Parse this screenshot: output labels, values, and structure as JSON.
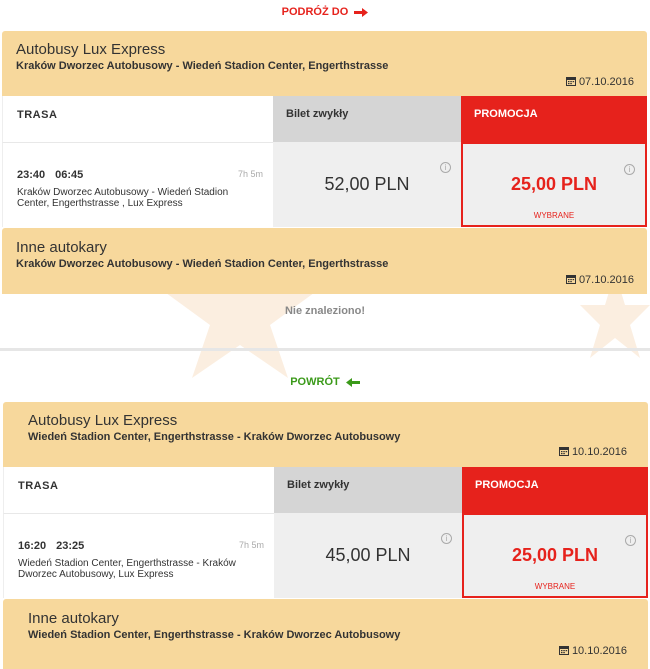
{
  "outbound": {
    "heading": "PODRÓŻ DO",
    "heading_color": "#e6221c",
    "lux": {
      "company": "Autobusy Lux Express",
      "route": "Kraków Dworzec Autobusowy - Wiedeń Stadion Center, Engerthstrasse",
      "date": "07.10.2016",
      "col_trasa": "TRASA",
      "col_bilet": "Bilet zwykły",
      "col_promo": "PROMOCJA",
      "dep": "23:40",
      "arr": "06:45",
      "duration": "7h 5m",
      "desc": "Kraków Dworzec Autobusowy - Wiedeń Stadion Center, Engerthstrasse , Lux Express",
      "price_regular": "52,00 PLN",
      "price_promo": "25,00 PLN",
      "selected": "WYBRANE"
    },
    "other": {
      "company": "Inne autokary",
      "route": "Kraków Dworzec Autobusowy - Wiedeń Stadion Center, Engerthstrasse",
      "date": "07.10.2016",
      "not_found": "Nie znaleziono!"
    }
  },
  "return": {
    "heading": "POWRÓT",
    "heading_color": "#3b9a1a",
    "lux": {
      "company": "Autobusy Lux Express",
      "route": "Wiedeń Stadion Center, Engerthstrasse - Kraków Dworzec Autobusowy",
      "date": "10.10.2016",
      "col_trasa": "TRASA",
      "col_bilet": "Bilet zwykły",
      "col_promo": "PROMOCJA",
      "dep": "16:20",
      "arr": "23:25",
      "duration": "7h 5m",
      "desc": "Wiedeń Stadion Center, Engerthstrasse - Kraków Dworzec Autobusowy, Lux Express",
      "price_regular": "45,00 PLN",
      "price_promo": "25,00 PLN",
      "selected": "WYBRANE"
    },
    "other": {
      "company": "Inne autokary",
      "route": "Wiedeń Stadion Center, Engerthstrasse - Kraków Dworzec Autobusowy",
      "date": "10.10.2016"
    }
  },
  "icons": {
    "info": "i",
    "calendar": "calendar-icon",
    "arrow_right": "arrow-right-icon",
    "arrow_left": "arrow-left-icon"
  },
  "colors": {
    "header_bg": "#f7d89c",
    "promo": "#e6221c",
    "regular_bg": "#d5d5d5"
  }
}
